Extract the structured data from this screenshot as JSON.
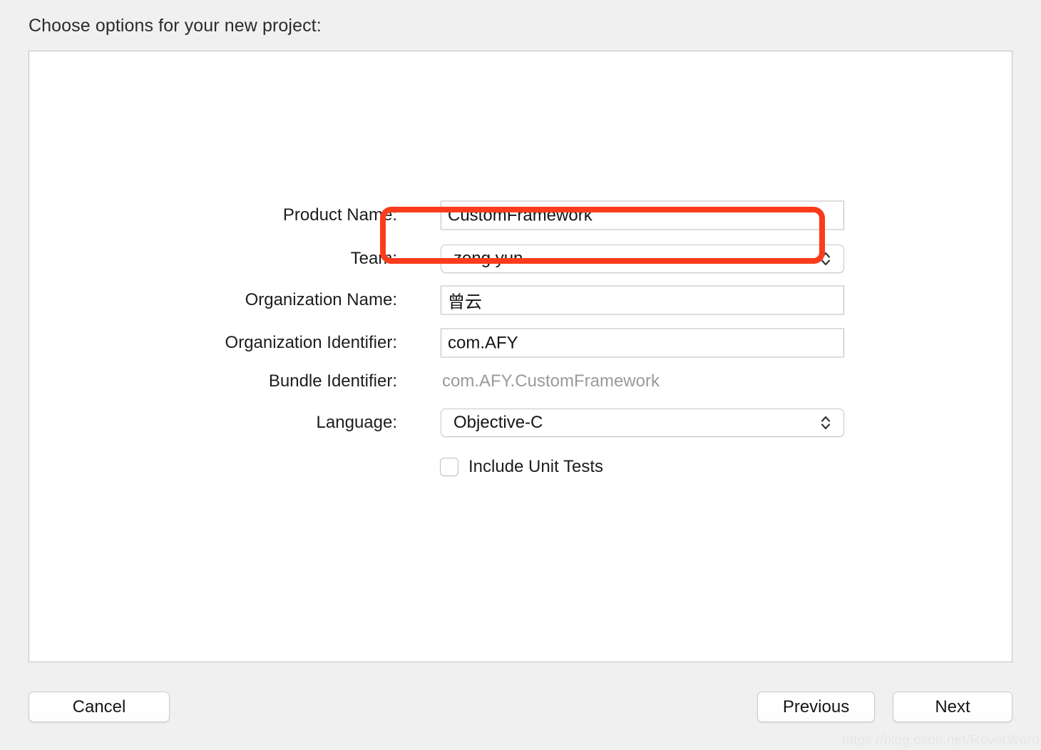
{
  "dialog": {
    "heading": "Choose options for your new project:"
  },
  "form": {
    "rows": [
      {
        "id": "product-name",
        "label": "Product Name:",
        "type": "text",
        "value": "CustomFramework",
        "placeholder": "",
        "highlighted": true
      },
      {
        "id": "team",
        "label": "Team:",
        "type": "popup",
        "value": "zeng yun",
        "icon": "stepper-updown-icon"
      },
      {
        "id": "organization-name",
        "label": "Organization Name:",
        "type": "text",
        "value": "曾云",
        "placeholder": ""
      },
      {
        "id": "organization-identifier",
        "label": "Organization Identifier:",
        "type": "text",
        "value": "com.AFY",
        "placeholder": ""
      },
      {
        "id": "bundle-identifier",
        "label": "Bundle Identifier:",
        "type": "static",
        "value": "com.AFY.CustomFramework"
      },
      {
        "id": "language",
        "label": "Language:",
        "type": "popup",
        "value": "Objective-C",
        "icon": "stepper-updown-icon"
      },
      {
        "id": "include-unit-tests",
        "label": "",
        "type": "checkbox",
        "checkbox_label": "Include Unit Tests",
        "checked": false
      }
    ]
  },
  "buttons": {
    "cancel": "Cancel",
    "previous": "Previous",
    "next": "Next"
  },
  "annotation": {
    "highlight_color": "#fa3c1c",
    "target": "product-name"
  },
  "watermark": {
    "text": "https://blog.csdn.net/RoverWord"
  },
  "colors": {
    "window_background": "#f0f0f0",
    "panel_background": "#ffffff",
    "panel_border": "#c2c2c2",
    "label_text": "#1d1d1d",
    "disabled_text": "#9a9a9a",
    "field_border": "#bdbdbd"
  }
}
